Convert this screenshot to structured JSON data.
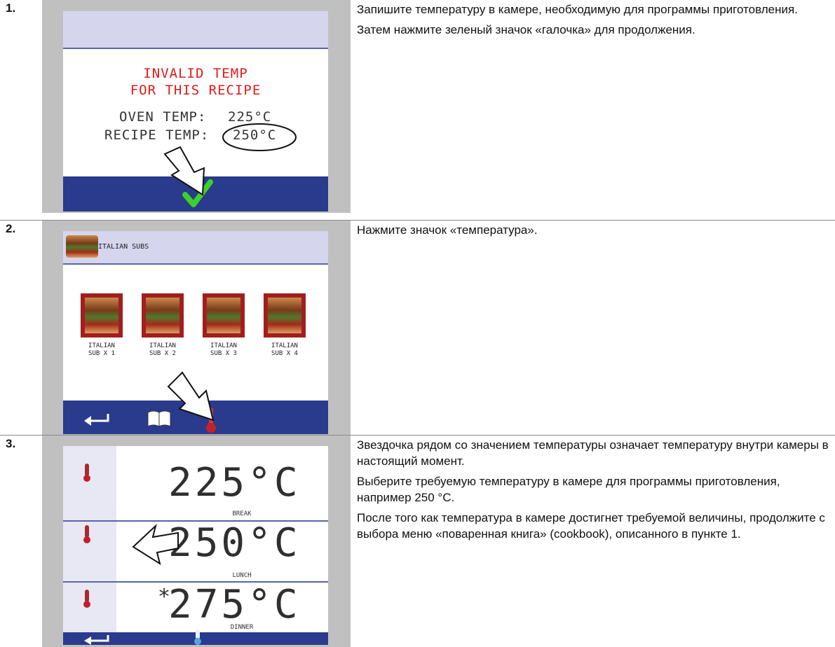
{
  "steps": [
    {
      "number": "1.",
      "screen": {
        "warning_line1": "INVALID TEMP",
        "warning_line2": "FOR THIS RECIPE",
        "oven_temp_label": "OVEN TEMP:",
        "oven_temp_value": "225°C",
        "recipe_temp_label": "RECIPE TEMP:",
        "recipe_temp_value": "250°C",
        "confirm_icon": "green-checkmark-icon"
      },
      "description": [
        "Запишите температуру в камере, необходимую для программы приготовления.",
        "Затем нажмите зеленый значок «галочка» для продолжения."
      ]
    },
    {
      "number": "2.",
      "screen": {
        "header_title": "ITALIAN SUBS",
        "tiles": [
          {
            "line1": "ITALIAN",
            "line2": "SUB X 1"
          },
          {
            "line1": "ITALIAN",
            "line2": "SUB X 2"
          },
          {
            "line1": "ITALIAN",
            "line2": "SUB X 3"
          },
          {
            "line1": "ITALIAN",
            "line2": "SUB X 4"
          }
        ],
        "toolbar_icons": [
          "back-arrow-icon",
          "cookbook-icon",
          "thermometer-icon"
        ]
      },
      "description": [
        "Нажмите значок «температура»."
      ]
    },
    {
      "number": "3.",
      "screen": {
        "temps": [
          {
            "value": "225°C",
            "label": "BREAK",
            "current": false
          },
          {
            "value": "250°C",
            "label": "LUNCH",
            "current": false
          },
          {
            "value": "275°C",
            "label": "DINNER",
            "current": true,
            "marker": "*"
          }
        ],
        "toolbar_icons": [
          "back-arrow-icon",
          "thermometer-icon"
        ]
      },
      "description": [
        "Звездочка рядом со значением температуры означает температуру внутри камеры в настоящий момент.",
        "Выберите требуемую температуру в камере для программы приготовления, например 250 °C.",
        "После того как температура в камере достигнет требуемой величины, продолжите с выбора меню «поваренная книга» (cookbook), описанного в пункте 1."
      ]
    }
  ],
  "colors": {
    "bar_blue": "#2a3a8c",
    "header_lavender": "#d5d6ee",
    "warning_red": "#e21a1a",
    "check_green": "#3bd12a",
    "tile_red": "#a21e1e",
    "frame_gray": "#c0c0c0"
  }
}
